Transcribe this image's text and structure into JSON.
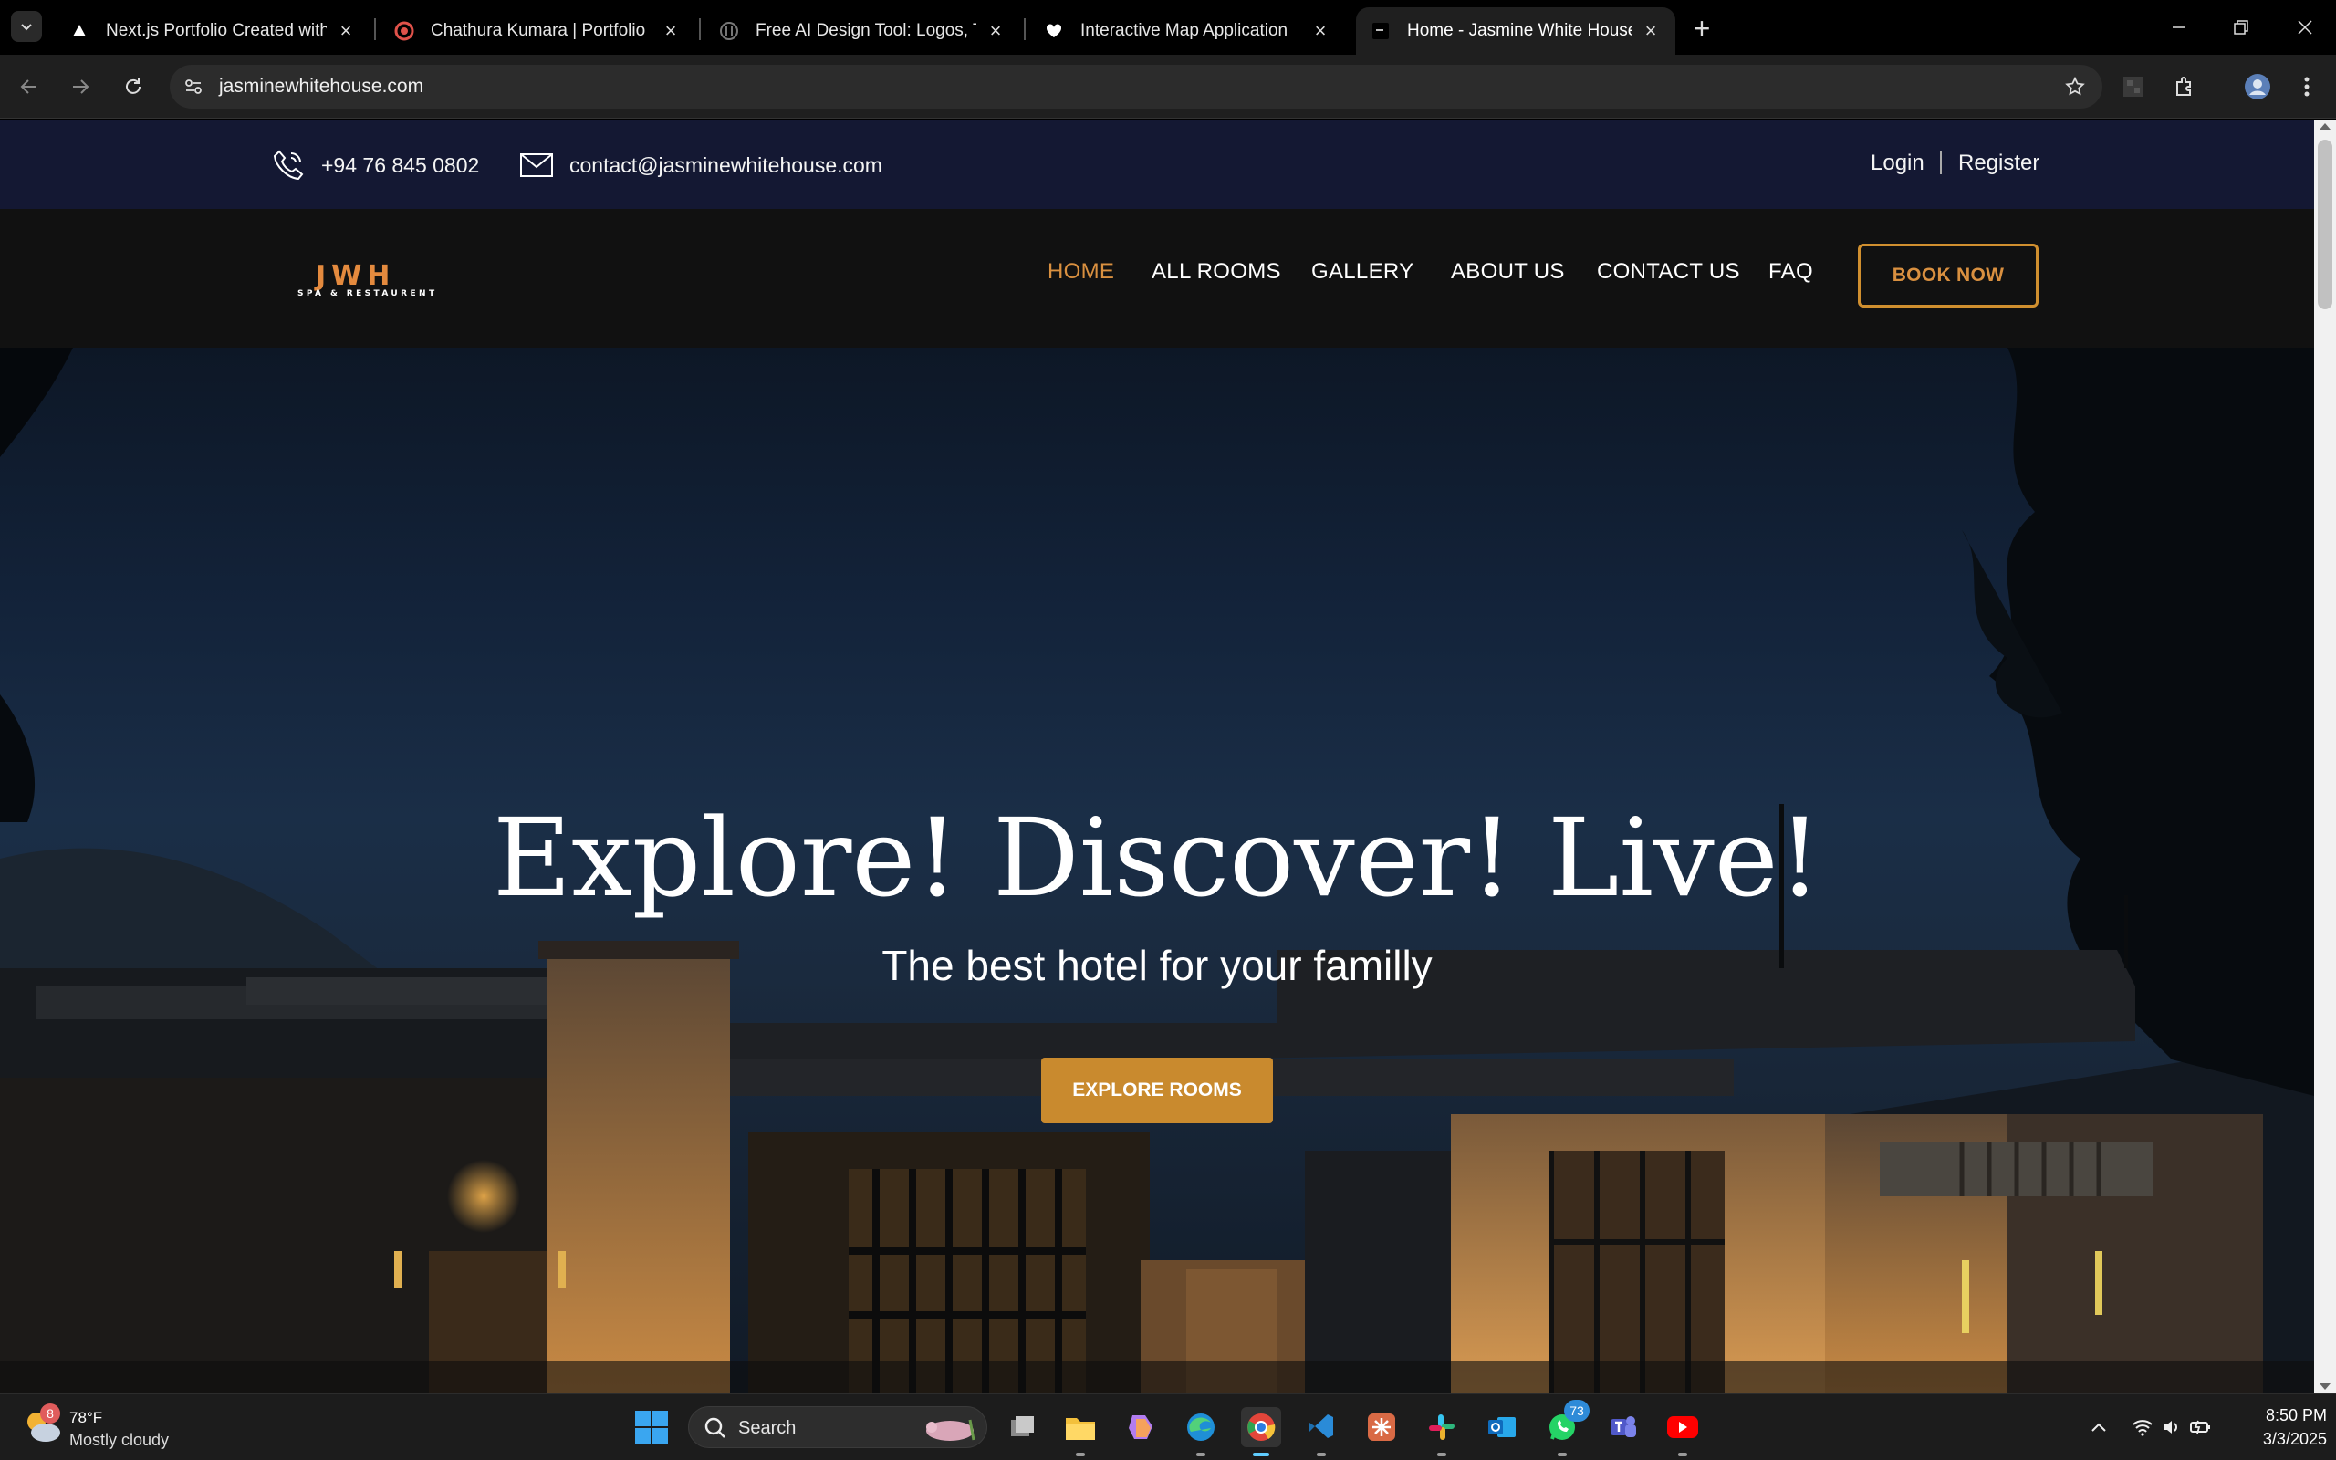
{
  "browser": {
    "tabs": [
      {
        "title": "Next.js Portfolio Created with Th",
        "favicon": "triangle-icon",
        "active": false
      },
      {
        "title": "Chathura Kumara | Portfolio",
        "favicon": "red-swirl-icon",
        "active": false
      },
      {
        "title": "Free AI Design Tool: Logos, T-Sh",
        "favicon": "design-tool-icon",
        "active": false
      },
      {
        "title": "Interactive Map Application",
        "favicon": "heart-icon",
        "active": false
      },
      {
        "title": "Home - Jasmine White House",
        "favicon": "site-icon",
        "active": true
      }
    ],
    "url": "jasminewhitehouse.com"
  },
  "site": {
    "topbar": {
      "phone": "+94 76 845 0802",
      "email": "contact@jasminewhitehouse.com",
      "login": "Login",
      "register": "Register"
    },
    "logo": {
      "main": "JWH",
      "tagline": "SPA & RESTAURENT"
    },
    "nav": {
      "items": [
        "HOME",
        "ALL ROOMS",
        "GALLERY",
        "ABOUT US",
        "CONTACT US",
        "FAQ"
      ],
      "active": "HOME",
      "book_now": "BOOK NOW"
    },
    "hero": {
      "title": "Explore! Discover! Live!",
      "subtitle": "The best hotel for your familly",
      "button": "EXPLORE ROOMS"
    }
  },
  "taskbar": {
    "weather": {
      "temp": "78°F",
      "desc": "Mostly cloudy",
      "badge": "8"
    },
    "search": "Search",
    "whatsapp_badge": "73",
    "time": "8:50 PM",
    "date": "3/3/2025"
  },
  "colors": {
    "accent": "#d99040",
    "topbar_bg": "#141833",
    "navbar_bg": "#111111",
    "button_bg": "#c98a2e"
  }
}
